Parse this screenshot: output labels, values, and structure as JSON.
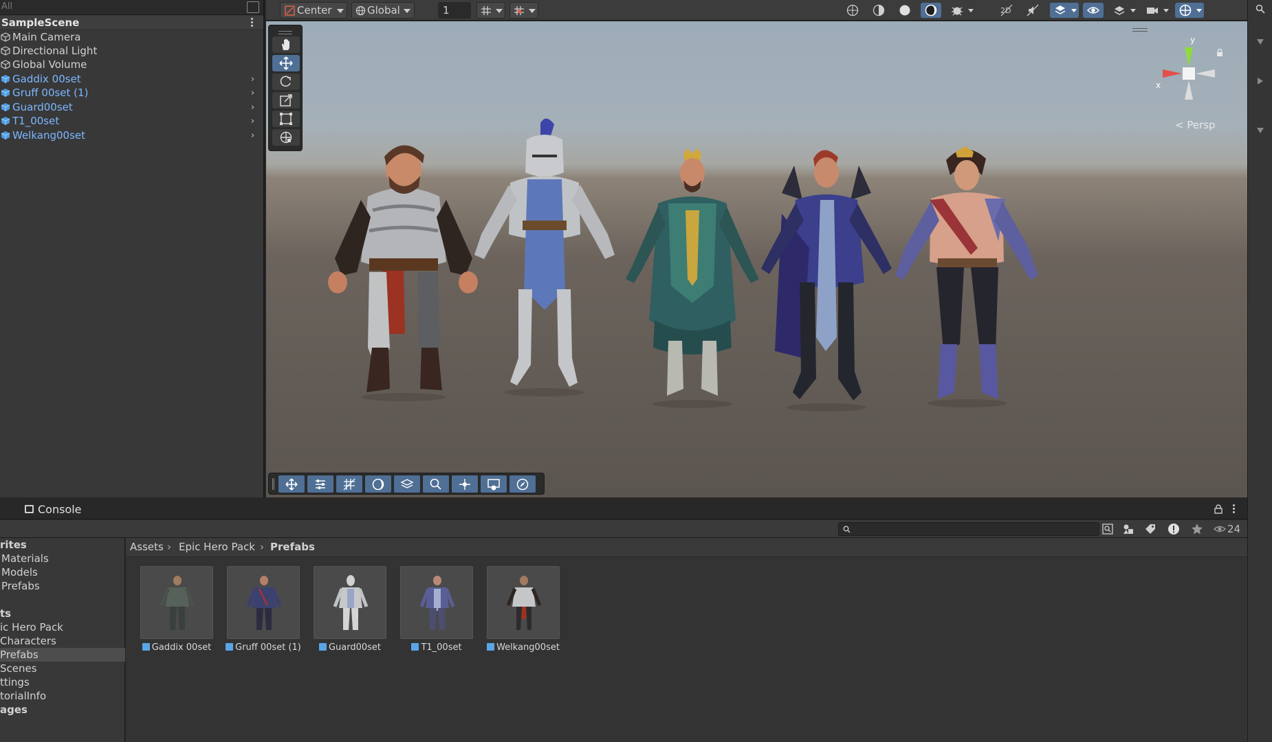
{
  "hierarchy": {
    "search_placeholder": "All",
    "scene": "SampleScene",
    "items": [
      {
        "label": "Main Camera",
        "prefab": false
      },
      {
        "label": "Directional Light",
        "prefab": false
      },
      {
        "label": "Global Volume",
        "prefab": false
      },
      {
        "label": "Gaddix 00set",
        "prefab": true
      },
      {
        "label": "Gruff 00set (1)",
        "prefab": true
      },
      {
        "label": "Guard00set",
        "prefab": true
      },
      {
        "label": "T1_00set",
        "prefab": true
      },
      {
        "label": "Welkang00set",
        "prefab": true
      }
    ]
  },
  "scene_toolbar": {
    "pivot": "Center",
    "space": "Global",
    "grid_increment": "1"
  },
  "viewport": {
    "projection": "< Persp",
    "axis_y": "y",
    "axis_x": "x",
    "colors": {
      "axis_x": "#e2504c",
      "axis_y": "#8ddc3c",
      "active_tool": "#4f6f95"
    }
  },
  "bottom": {
    "tab": "Console",
    "count": "24",
    "left_items": [
      {
        "label": "rites",
        "bold": true
      },
      {
        "label": "Materials"
      },
      {
        "label": "Models"
      },
      {
        "label": "Prefabs"
      },
      {
        "label": ""
      },
      {
        "label": "ts",
        "bold": true
      },
      {
        "label": "ic Hero Pack"
      },
      {
        "label": "Characters"
      },
      {
        "label": "Prefabs",
        "selected": true
      },
      {
        "label": "Scenes"
      },
      {
        "label": "ttings"
      },
      {
        "label": "torialInfo"
      },
      {
        "label": "ages",
        "bold": true
      }
    ],
    "breadcrumb": [
      "Assets",
      "Epic Hero Pack",
      "Prefabs"
    ],
    "assets": [
      {
        "name": "Gaddix 00set"
      },
      {
        "name": "Gruff 00set (1)"
      },
      {
        "name": "Guard00set"
      },
      {
        "name": "T1_00set"
      },
      {
        "name": "Welkang00set"
      }
    ]
  }
}
